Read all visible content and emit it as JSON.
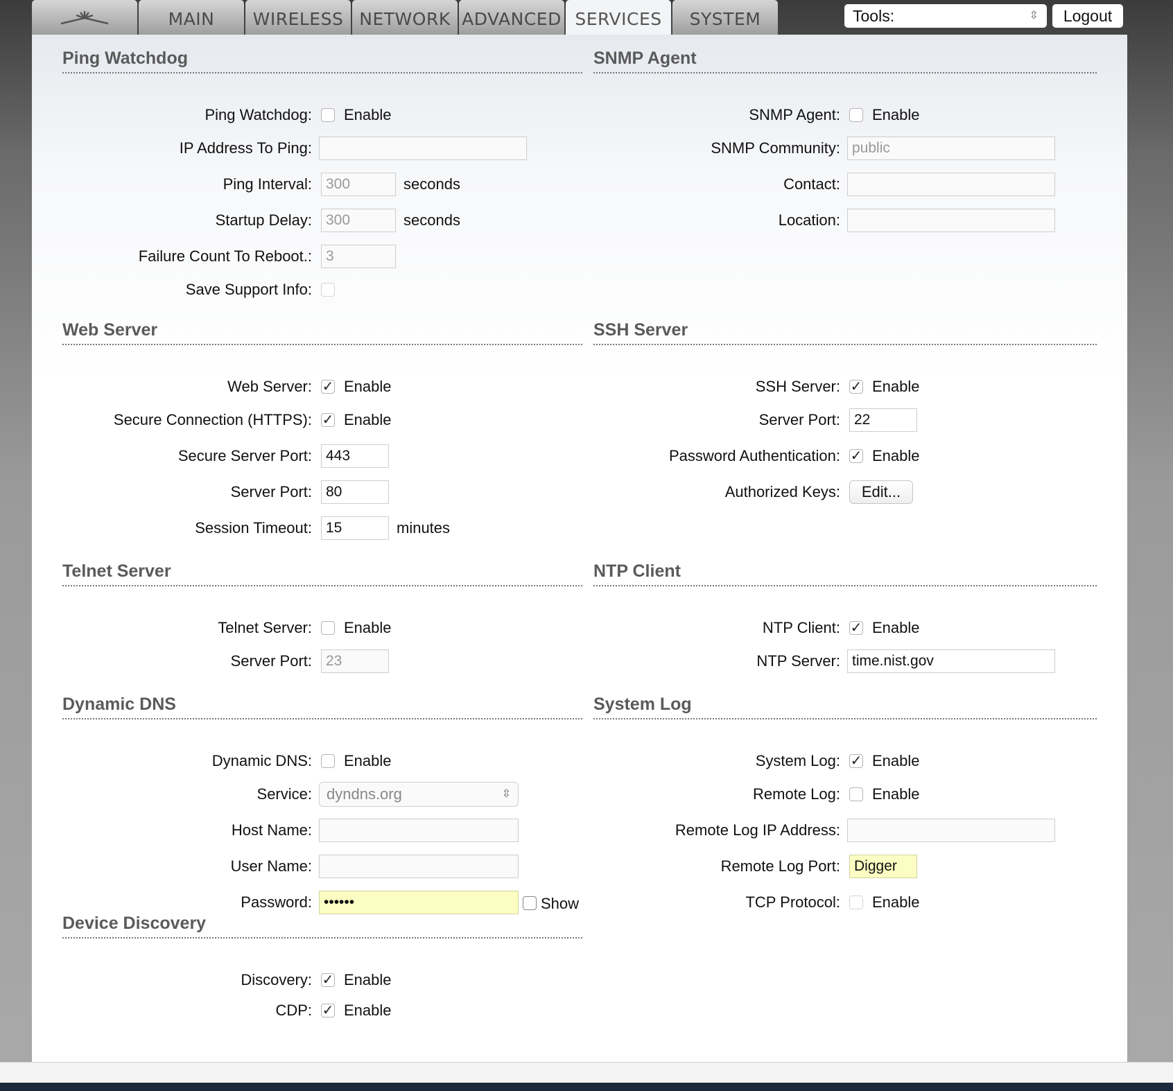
{
  "tabs": {
    "main": "MAIN",
    "wireless": "WIRELESS",
    "network": "NETWORK",
    "advanced": "ADVANCED",
    "services": "SERVICES",
    "system": "SYSTEM"
  },
  "toolbar": {
    "tools_label": "Tools:",
    "logout": "Logout"
  },
  "common": {
    "enable": "Enable",
    "seconds": "seconds",
    "minutes": "minutes",
    "show": "Show"
  },
  "ping_watchdog": {
    "title": "Ping Watchdog",
    "enable_label": "Ping Watchdog:",
    "enabled": false,
    "ip_label": "IP Address To Ping:",
    "ip_value": "",
    "interval_label": "Ping Interval:",
    "interval_value": "300",
    "delay_label": "Startup Delay:",
    "delay_value": "300",
    "failure_label": "Failure Count To Reboot.:",
    "failure_value": "3",
    "support_label": "Save Support Info:",
    "support_checked": false
  },
  "snmp": {
    "title": "SNMP Agent",
    "enable_label": "SNMP Agent:",
    "enabled": false,
    "community_label": "SNMP Community:",
    "community_value": "public",
    "contact_label": "Contact:",
    "contact_value": "",
    "location_label": "Location:",
    "location_value": ""
  },
  "web_server": {
    "title": "Web Server",
    "enable_label": "Web Server:",
    "enabled": true,
    "https_label": "Secure Connection (HTTPS):",
    "https_enabled": true,
    "secure_port_label": "Secure Server Port:",
    "secure_port_value": "443",
    "port_label": "Server Port:",
    "port_value": "80",
    "timeout_label": "Session Timeout:",
    "timeout_value": "15"
  },
  "ssh_server": {
    "title": "SSH Server",
    "enable_label": "SSH Server:",
    "enabled": true,
    "port_label": "Server Port:",
    "port_value": "22",
    "password_label": "Password Authentication:",
    "password_enabled": true,
    "keys_label": "Authorized Keys:",
    "keys_button": "Edit..."
  },
  "telnet": {
    "title": "Telnet Server",
    "enable_label": "Telnet Server:",
    "enabled": false,
    "port_label": "Server Port:",
    "port_value": "23"
  },
  "ntp": {
    "title": "NTP Client",
    "enable_label": "NTP Client:",
    "enabled": true,
    "server_label": "NTP Server:",
    "server_value": "time.nist.gov"
  },
  "ddns": {
    "title": "Dynamic DNS",
    "enable_label": "Dynamic DNS:",
    "enabled": false,
    "service_label": "Service:",
    "service_value": "dyndns.org",
    "host_label": "Host Name:",
    "host_value": "",
    "user_label": "User Name:",
    "user_value": "",
    "password_label": "Password:",
    "password_value": "••••••"
  },
  "syslog": {
    "title": "System Log",
    "enable_label": "System Log:",
    "enabled": true,
    "remote_label": "Remote Log:",
    "remote_enabled": false,
    "remote_ip_label": "Remote Log IP Address:",
    "remote_ip_value": "",
    "remote_port_label": "Remote Log Port:",
    "remote_port_value": "Digger",
    "tcp_label": "TCP Protocol:",
    "tcp_enabled": false
  },
  "discovery": {
    "title": "Device Discovery",
    "enable_label": "Discovery:",
    "enabled": true,
    "cdp_label": "CDP:",
    "cdp_enabled": true
  }
}
